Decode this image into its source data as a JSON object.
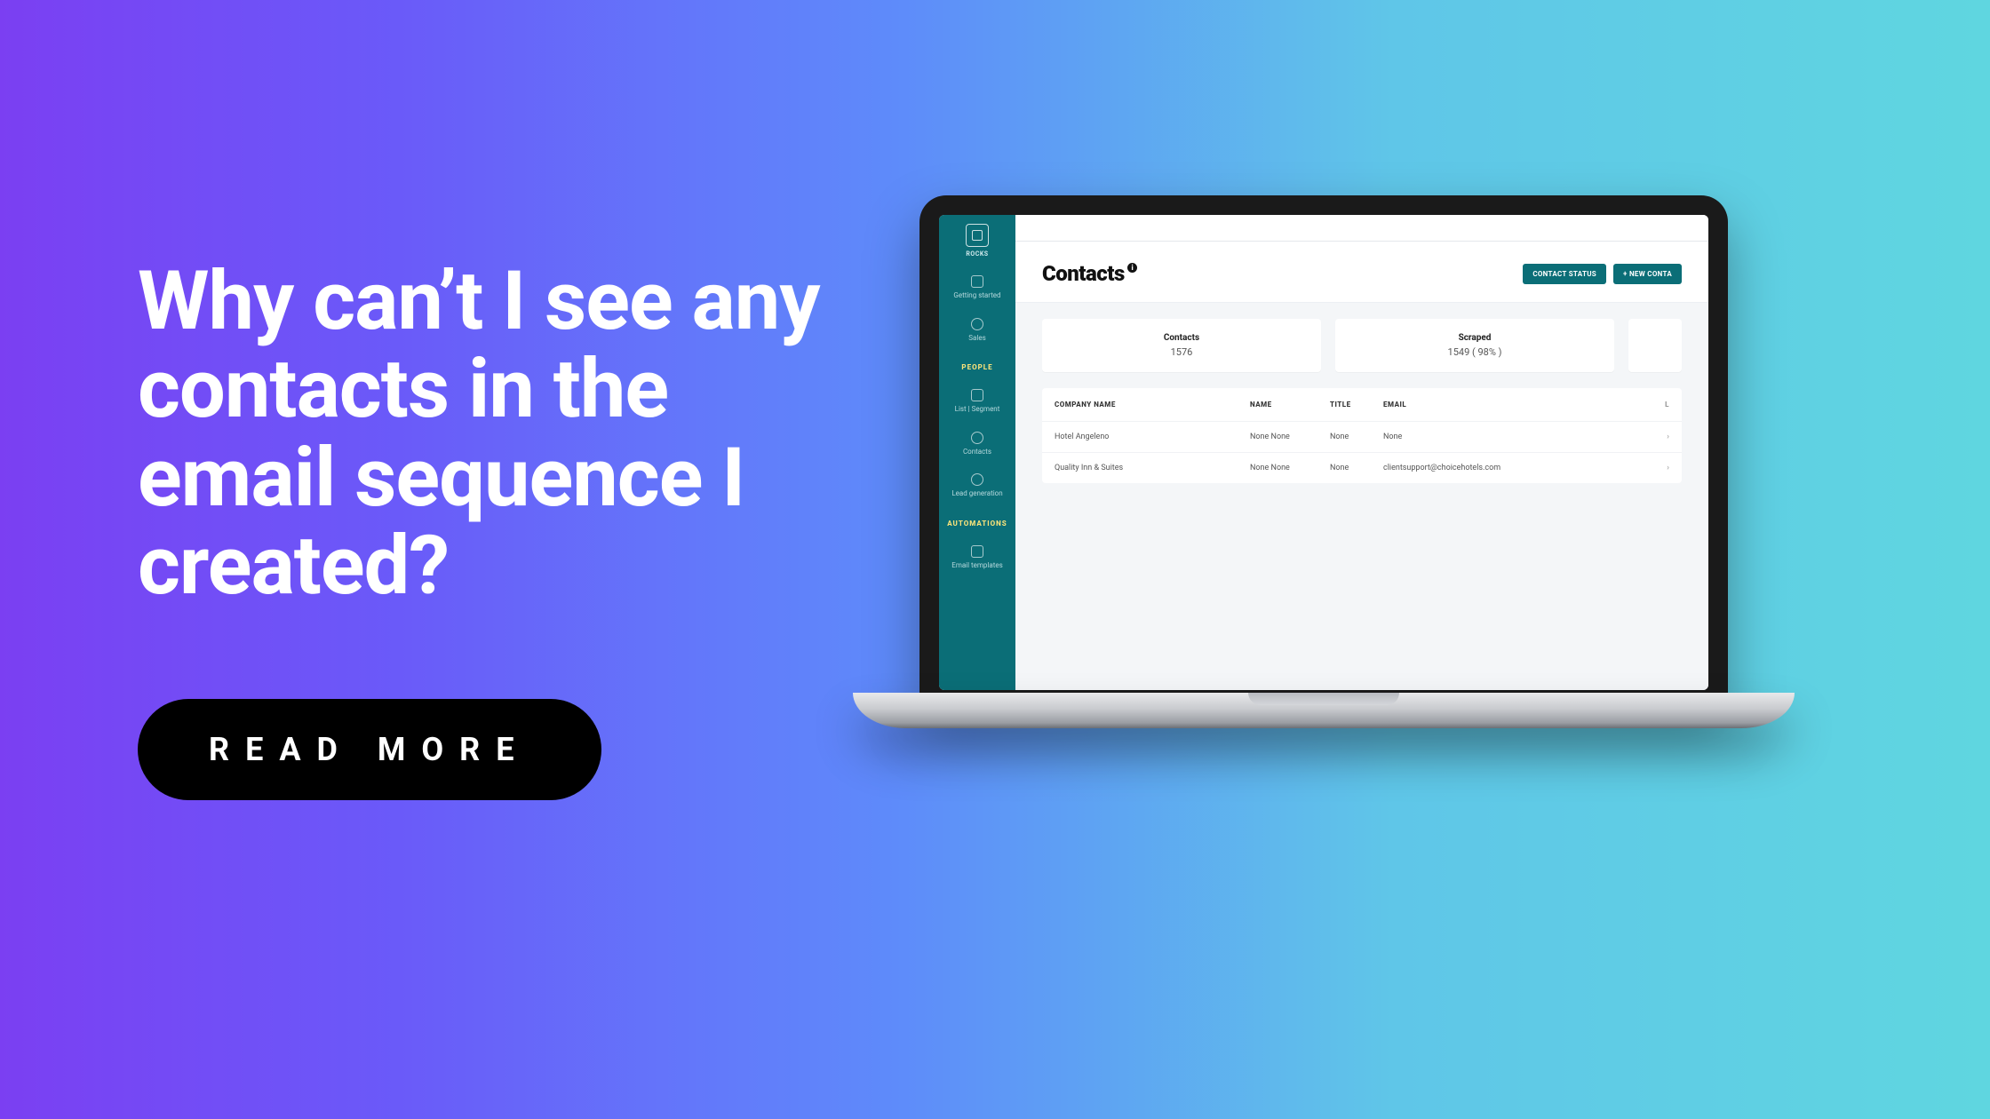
{
  "hero": {
    "title": "Why can’t I see any contacts in the email sequence I created?",
    "cta": "READ MORE"
  },
  "app": {
    "brand": "ROCKS",
    "sidebar": {
      "items_top": [
        {
          "label": "Getting started"
        },
        {
          "label": "Sales"
        }
      ],
      "section_people": "PEOPLE",
      "items_people": [
        {
          "label": "List | Segment"
        },
        {
          "label": "Contacts"
        },
        {
          "label": "Lead generation"
        }
      ],
      "section_automations": "AUTOMATIONS",
      "items_automations": [
        {
          "label": "Email templates"
        }
      ]
    },
    "header": {
      "title": "Contacts",
      "info": "i",
      "buttons": {
        "status": "CONTACT STATUS",
        "new": "+ NEW CONTA"
      }
    },
    "stats": [
      {
        "label": "Contacts",
        "value": "1576"
      },
      {
        "label": "Scraped",
        "value": "1549 ( 98% )"
      }
    ],
    "table": {
      "columns": {
        "c1": "COMPANY NAME",
        "c2": "NAME",
        "c3": "TITLE",
        "c4": "EMAIL",
        "c5": "L"
      },
      "rows": [
        {
          "c1": "Hotel Angeleno",
          "c2": "None None",
          "c3": "None",
          "c4": "None",
          "c5": "›"
        },
        {
          "c1": "Quality Inn & Suites",
          "c2": "None None",
          "c3": "None",
          "c4": "clientsupport@choicehotels.com",
          "c5": "›"
        }
      ]
    }
  }
}
